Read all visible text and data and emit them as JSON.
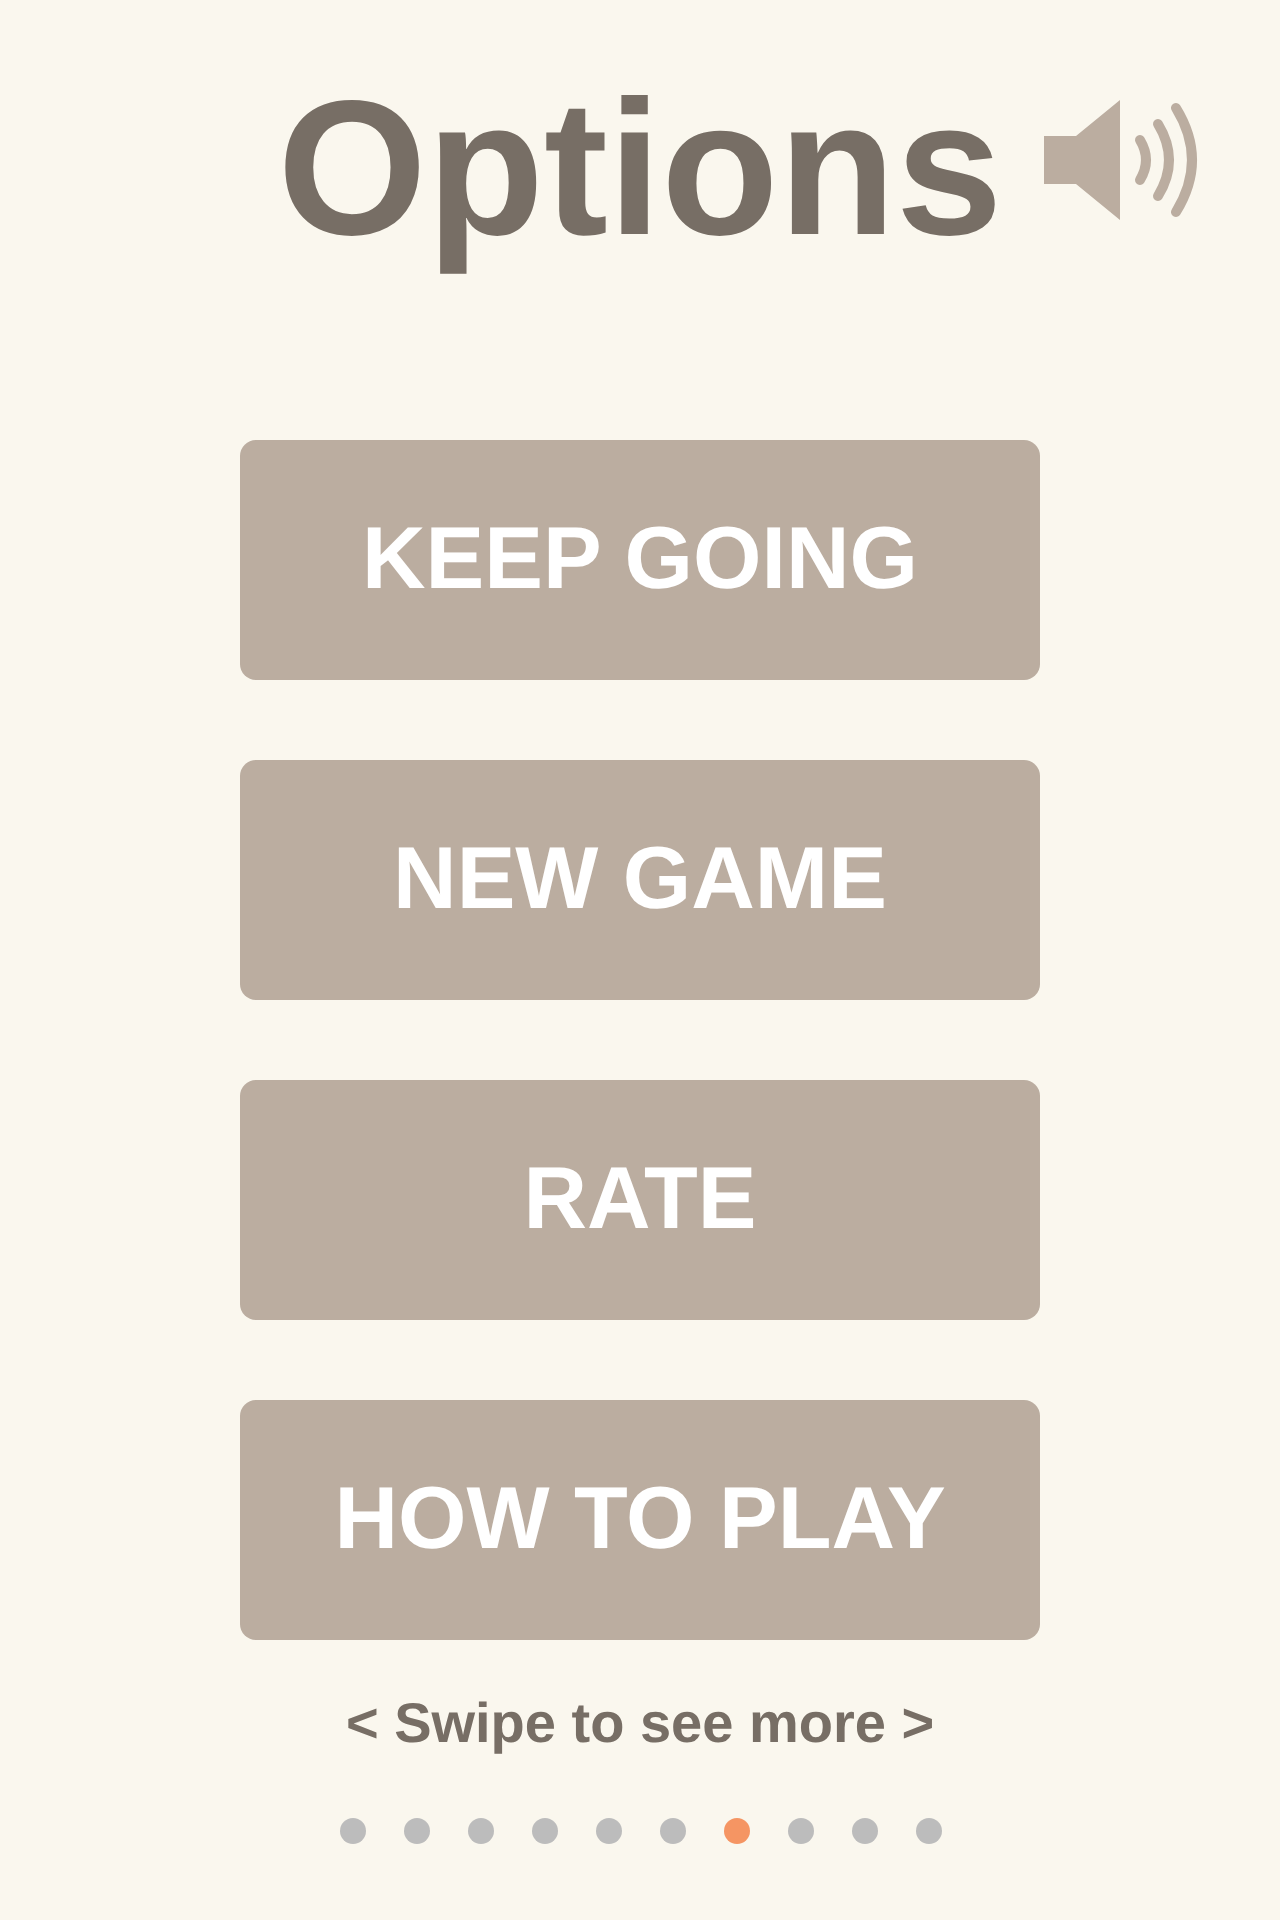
{
  "title": "Options",
  "sound": {
    "on": true
  },
  "buttons": [
    {
      "label": "KEEP GOING"
    },
    {
      "label": "NEW GAME"
    },
    {
      "label": "RATE"
    },
    {
      "label": "HOW TO PLAY"
    }
  ],
  "hint": "< Swipe to see more >",
  "pages": [
    {
      "selected": false
    },
    {
      "selected": false
    },
    {
      "selected": false
    },
    {
      "selected": false
    },
    {
      "selected": false
    },
    {
      "selected": false
    },
    {
      "selected": true
    },
    {
      "selected": false
    },
    {
      "selected": false
    },
    {
      "selected": false
    }
  ]
}
